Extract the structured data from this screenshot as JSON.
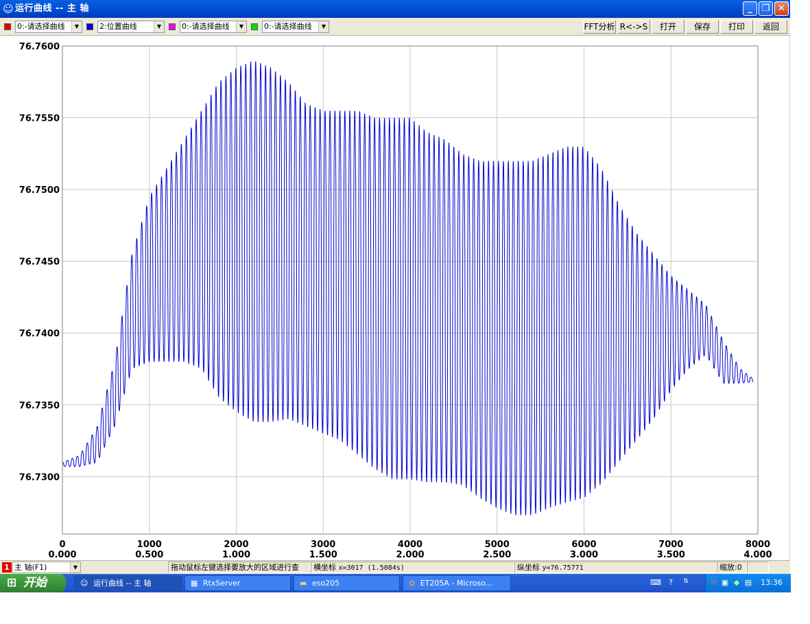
{
  "window": {
    "title": "运行曲线 -- 主  轴"
  },
  "toolbar": {
    "channels": [
      {
        "color": "#e00000",
        "value": "0:-请选择曲线"
      },
      {
        "color": "#0000e0",
        "value": "2:位置曲线"
      },
      {
        "color": "#ff00ff",
        "value": "0:-请选择曲线"
      },
      {
        "color": "#00e000",
        "value": "0:-请选择曲线"
      }
    ],
    "buttons": {
      "fft": "FFT分析",
      "rs": "R<->S",
      "open": "打开",
      "save": "保存",
      "print": "打印",
      "back": "返回"
    }
  },
  "chart_data": {
    "type": "line",
    "title": "",
    "xlabel": "",
    "ylabel": "",
    "xlim": [
      0,
      8000
    ],
    "ylim": [
      76.726,
      76.76
    ],
    "x_ticks_samples": [
      "0",
      "1000",
      "2000",
      "3000",
      "4000",
      "5000",
      "6000",
      "7000",
      "8000"
    ],
    "x_ticks_seconds": [
      "0.000",
      "0.500",
      "1.000",
      "1.500",
      "2.000",
      "2.500",
      "3.000",
      "3.500",
      "4.000"
    ],
    "y_ticks": [
      "76.7600",
      "76.7550",
      "76.7500",
      "76.7450",
      "76.7400",
      "76.7350",
      "76.7300"
    ],
    "grid": true,
    "series": [
      {
        "color": "#0000cc",
        "oscillation_period_samples": 57,
        "envelope": {
          "x": [
            0,
            200,
            400,
            600,
            800,
            1000,
            1200,
            1400,
            1600,
            1800,
            2000,
            2200,
            2400,
            2600,
            2800,
            3000,
            3200,
            3400,
            3600,
            3800,
            4000,
            4200,
            4400,
            4600,
            4800,
            5000,
            5200,
            5400,
            5600,
            5800,
            6000,
            6200,
            6400,
            6600,
            6800,
            7000,
            7200,
            7400,
            7600,
            7800,
            7950
          ],
          "upper": [
            76.731,
            76.7315,
            76.7335,
            76.738,
            76.7455,
            76.7495,
            76.7515,
            76.7535,
            76.7555,
            76.7575,
            76.7585,
            76.759,
            76.7585,
            76.7575,
            76.756,
            76.7555,
            76.7555,
            76.7555,
            76.755,
            76.755,
            76.755,
            76.754,
            76.7535,
            76.7525,
            76.752,
            76.752,
            76.752,
            76.752,
            76.7525,
            76.753,
            76.753,
            76.7515,
            76.749,
            76.747,
            76.7455,
            76.744,
            76.743,
            76.742,
            76.7395,
            76.7375,
            76.7368
          ],
          "lower": [
            76.7307,
            76.7307,
            76.731,
            76.7335,
            76.7375,
            76.738,
            76.738,
            76.738,
            76.7375,
            76.7355,
            76.7345,
            76.7338,
            76.7338,
            76.734,
            76.7335,
            76.733,
            76.7325,
            76.7315,
            76.7305,
            76.7298,
            76.7298,
            76.7296,
            76.7296,
            76.7294,
            76.7285,
            76.7278,
            76.7273,
            76.7273,
            76.7278,
            76.7282,
            76.7285,
            76.7295,
            76.731,
            76.7325,
            76.734,
            76.736,
            76.7375,
            76.7385,
            76.7365,
            76.7365,
            76.7366
          ]
        }
      }
    ]
  },
  "statusbar": {
    "axis_tag": "1",
    "axis_select": "主  轴(F1)",
    "hint": "拖动鼠标左键选择要放大的区域进行查",
    "x_label": "横坐标",
    "x_value": "x=3017  (1.5084s)",
    "y_label": "纵坐标",
    "y_value": "y=76.75771",
    "zoom": "缩放:0"
  },
  "taskbar": {
    "start": "开始",
    "tasks": [
      "运行曲线 -- 主  轴",
      "RtxServer",
      "eso205",
      "ET205A - Microso..."
    ],
    "clock": "13:36"
  }
}
